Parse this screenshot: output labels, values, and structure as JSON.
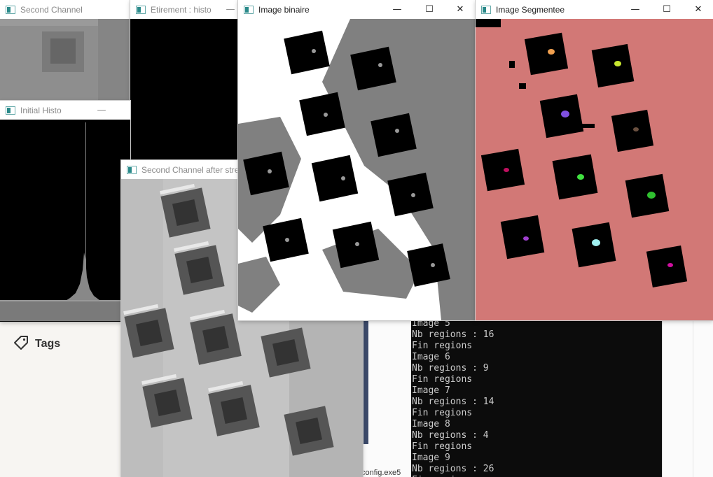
{
  "windows": {
    "second_channel": {
      "title": "Second Channel",
      "controls": []
    },
    "etirement_histo": {
      "title": "Etirement : histo",
      "controls": [
        "—"
      ]
    },
    "initial_histo": {
      "title": "Initial Histo",
      "controls": [
        "—"
      ]
    },
    "second_channel_stretched": {
      "title": "Second Channel after stretching"
    },
    "image_binaire": {
      "title": "Image binaire",
      "controls": [
        "—",
        "☐",
        "✕"
      ]
    },
    "image_segmentee": {
      "title": "Image Segmentee",
      "controls": [
        "—",
        "☐",
        "✕"
      ]
    }
  },
  "sidebar": {
    "tags_label": "Tags",
    "tags_icon": "tag-icon"
  },
  "editor": {
    "file_label": "config.exe5"
  },
  "console": {
    "lines": [
      "Image 5",
      "Nb regions : 16",
      "Fin regions",
      "Image 6",
      "Nb regions : 9",
      "Fin regions",
      "Image 7",
      "Nb regions : 14",
      "Fin regions",
      "Image 8",
      "Nb regions : 4",
      "Fin regions",
      "Image 9",
      "Nb regions : 26",
      "Fin regions"
    ]
  },
  "colors": {
    "segment_background": "#d27876",
    "segment_markers": [
      "#f0a050",
      "#c8e830",
      "#8050e0",
      "#6a5040",
      "#c01060",
      "#40e040",
      "#30c030",
      "#a040d0",
      "#a0f0f0",
      "#d010a0"
    ],
    "binary_gray": "#808080",
    "console_bg": "#0c0c0c"
  }
}
